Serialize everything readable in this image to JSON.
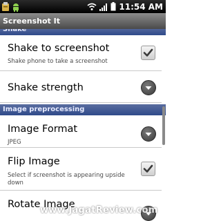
{
  "status_bar": {
    "time": "11:54 AM",
    "icons": [
      "usb-icon",
      "android-icon",
      "wifi-icon",
      "signal-icon",
      "battery-icon"
    ]
  },
  "app": {
    "title": "Screenshot It"
  },
  "sections": [
    {
      "header": "Shake",
      "items": [
        {
          "title": "Shake to screenshot",
          "summary": "Shake phone to take a screenshot",
          "control": "checkbox",
          "checked": true
        },
        {
          "title": "Shake strength",
          "summary": "",
          "control": "dropdown"
        }
      ]
    },
    {
      "header": "Image preprocessing",
      "items": [
        {
          "title": "Image Format",
          "summary": "JPEG",
          "control": "dropdown"
        },
        {
          "title": "Flip Image",
          "summary": "Select if screenshot is appearing upside down",
          "control": "checkbox",
          "checked": true
        },
        {
          "title": "Rotate Image",
          "summary": "",
          "control": "dropdown"
        }
      ]
    }
  ],
  "watermark": "www.JagatReview.com",
  "colors": {
    "category_header": "#3a5595",
    "title_bar": "#6b6b6b",
    "status_bar": "#000000"
  }
}
